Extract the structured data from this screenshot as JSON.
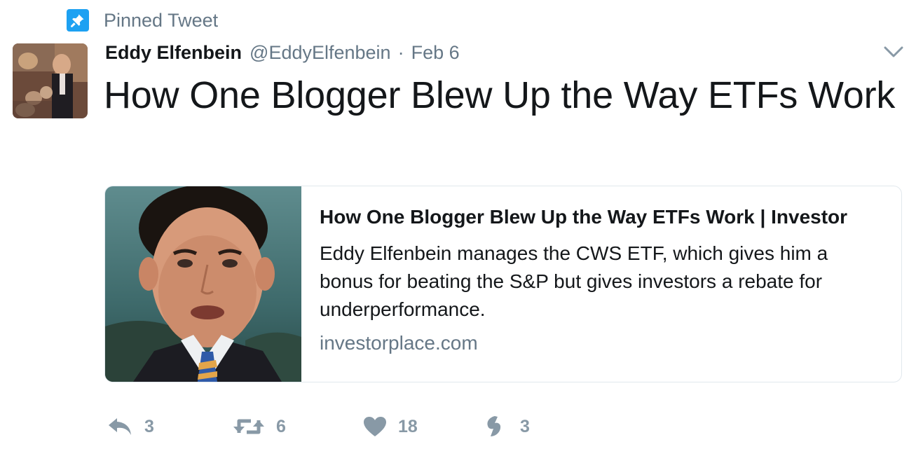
{
  "pinned": {
    "label": "Pinned Tweet"
  },
  "author": {
    "name": "Eddy Elfenbein",
    "handle": "@EddyElfenbein",
    "separator": "·",
    "date": "Feb 6"
  },
  "tweet": {
    "text": "How One Blogger Blew Up the Way ETFs Work"
  },
  "card": {
    "title": "How One Blogger Blew Up the Way ETFs Work | Investor",
    "description": "Eddy Elfenbein manages the CWS ETF, which gives him a bonus for beating the S&P but gives investors a rebate for underperformance.",
    "domain": "investorplace.com"
  },
  "actions": {
    "reply_count": "3",
    "retweet_count": "6",
    "like_count": "18",
    "moments_count": "3"
  },
  "colors": {
    "brand": "#1da1f2",
    "secondary_text": "#657786",
    "action_icon": "#8899a6",
    "card_border": "#e1e8ed"
  },
  "icons": [
    "pin-icon",
    "caret-down-icon",
    "reply-icon",
    "retweet-icon",
    "heart-icon",
    "moments-icon"
  ]
}
